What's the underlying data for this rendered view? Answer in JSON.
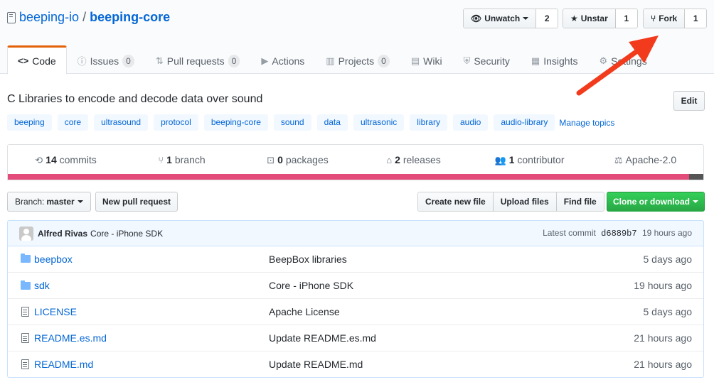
{
  "repo": {
    "owner": "beeping-io",
    "separator": "/",
    "name": "beeping-core"
  },
  "actions": {
    "watch": {
      "label": "Unwatch",
      "count": "2"
    },
    "star": {
      "label": "Unstar",
      "count": "1"
    },
    "fork": {
      "label": "Fork",
      "count": "1"
    }
  },
  "tabs": [
    {
      "label": "Code",
      "icon": "code-icon"
    },
    {
      "label": "Issues",
      "icon": "issue-icon",
      "count": "0"
    },
    {
      "label": "Pull requests",
      "icon": "pull-request-icon",
      "count": "0"
    },
    {
      "label": "Actions",
      "icon": "play-icon"
    },
    {
      "label": "Projects",
      "icon": "project-icon",
      "count": "0"
    },
    {
      "label": "Wiki",
      "icon": "book-icon"
    },
    {
      "label": "Security",
      "icon": "shield-icon"
    },
    {
      "label": "Insights",
      "icon": "graph-icon"
    },
    {
      "label": "Settings",
      "icon": "gear-icon"
    }
  ],
  "description": "C Libraries to encode and decode data over sound",
  "edit_label": "Edit",
  "topics": [
    "beeping",
    "core",
    "ultrasound",
    "protocol",
    "beeping-core",
    "sound",
    "data",
    "ultrasonic",
    "library",
    "audio",
    "audio-library"
  ],
  "manage_topics": "Manage topics",
  "summary": {
    "commits": {
      "num": "14",
      "label": "commits"
    },
    "branches": {
      "num": "1",
      "label": "branch"
    },
    "packages": {
      "num": "0",
      "label": "packages"
    },
    "releases": {
      "num": "2",
      "label": "releases"
    },
    "contributors": {
      "num": "1",
      "label": "contributor"
    },
    "license": "Apache-2.0"
  },
  "language_colors": {
    "primary": "#e34c7a",
    "secondary": "#555555"
  },
  "file_nav": {
    "branch_prefix": "Branch:",
    "branch": "master",
    "new_pr": "New pull request",
    "create_file": "Create new file",
    "upload_files": "Upload files",
    "find_file": "Find file",
    "clone": "Clone or download"
  },
  "latest_commit": {
    "author": "Alfred Rivas",
    "message": "Core - iPhone SDK",
    "prefix": "Latest commit",
    "sha": "d6889b7",
    "age": "19 hours ago"
  },
  "files": [
    {
      "type": "folder",
      "name": "beepbox",
      "message": "BeepBox libraries",
      "age": "5 days ago"
    },
    {
      "type": "folder",
      "name": "sdk",
      "message": "Core - iPhone SDK",
      "age": "19 hours ago"
    },
    {
      "type": "file",
      "name": "LICENSE",
      "message": "Apache License",
      "age": "5 days ago"
    },
    {
      "type": "file",
      "name": "README.es.md",
      "message": "Update README.es.md",
      "age": "21 hours ago"
    },
    {
      "type": "file",
      "name": "README.md",
      "message": "Update README.md",
      "age": "21 hours ago"
    }
  ],
  "accent_colors": {
    "link": "#0366d6",
    "tab_active": "#e36209",
    "clone_button": "#28a745",
    "annotation_arrow": "#f23b1d"
  }
}
